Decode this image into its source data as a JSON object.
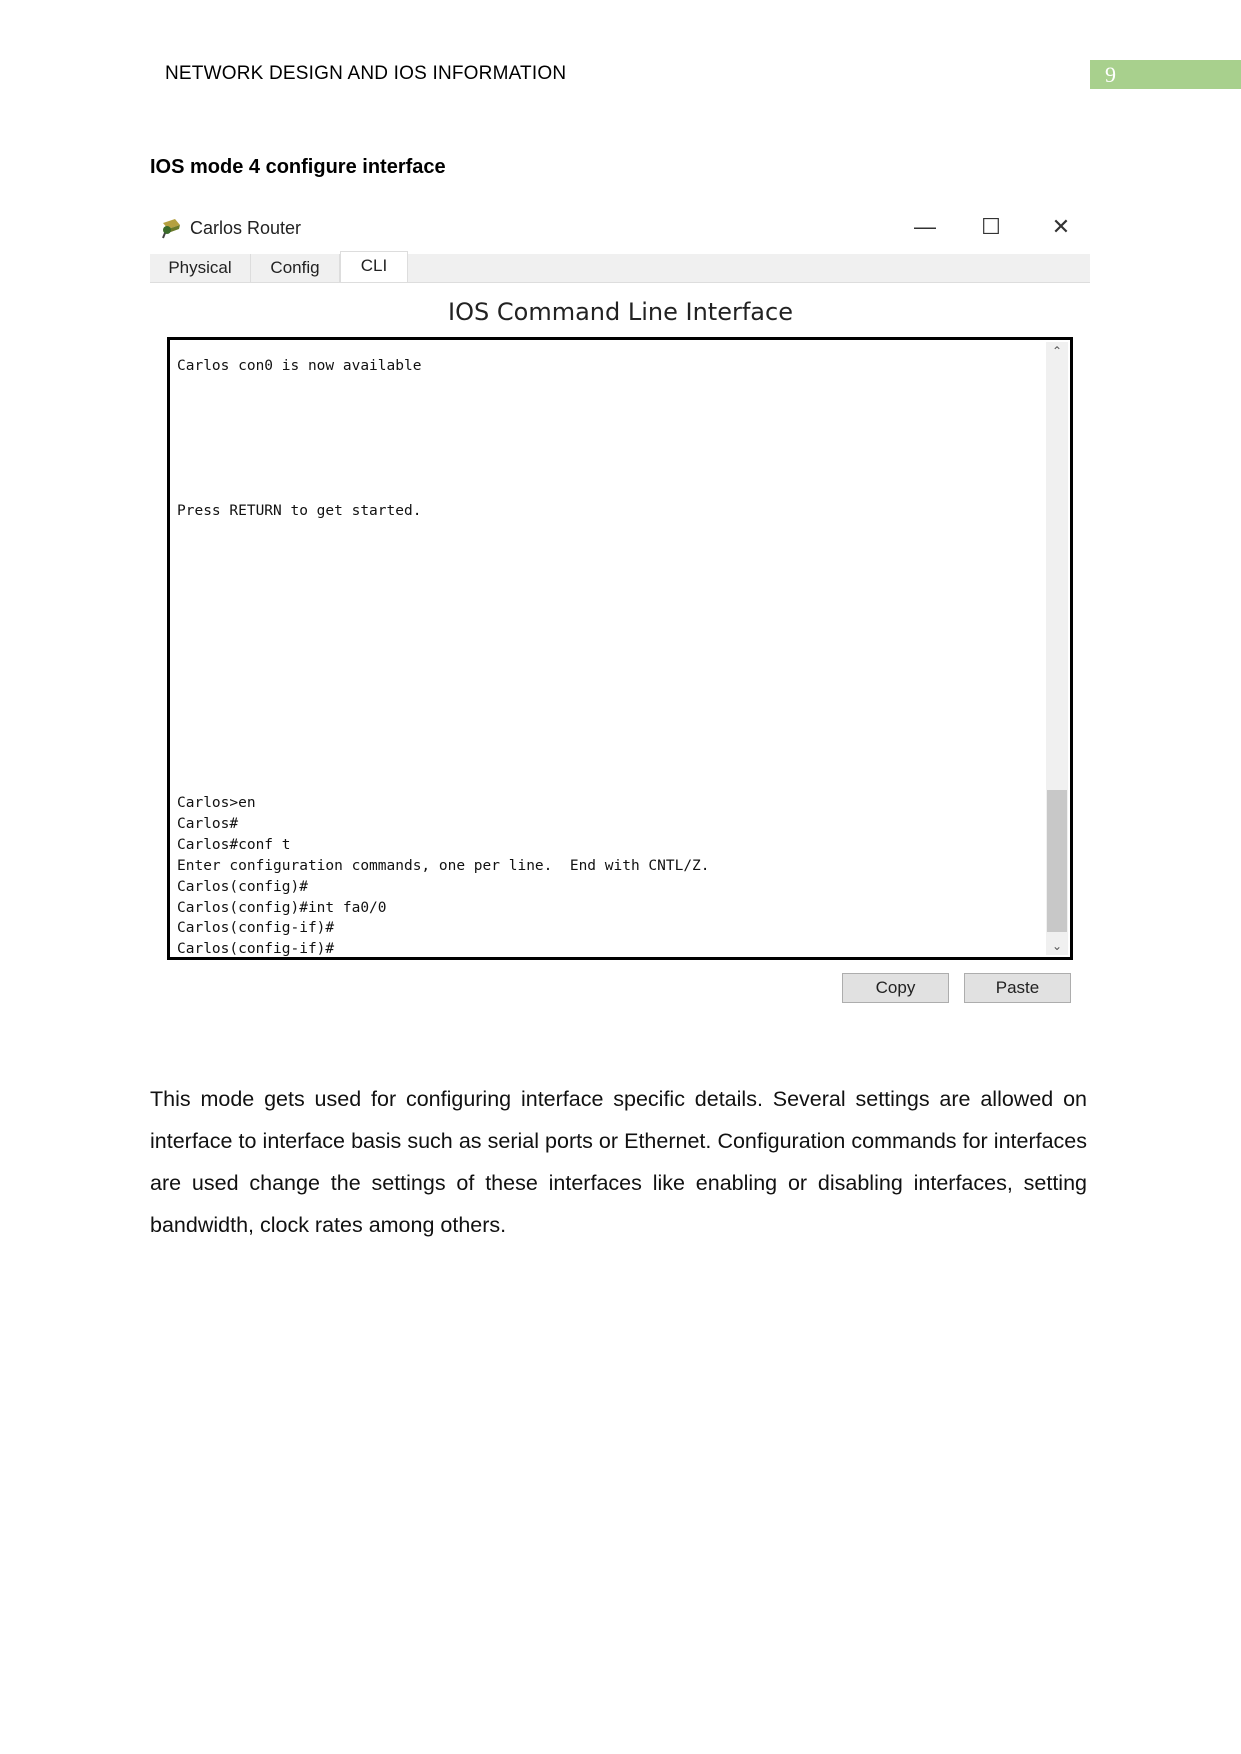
{
  "header": {
    "title": "NETWORK DESIGN AND IOS INFORMATION",
    "page_number": "9",
    "accent": "#a8d08d"
  },
  "heading": "IOS mode 4 configure interface",
  "window": {
    "title": "Carlos Router",
    "controls": {
      "minimize": "—",
      "maximize": "☐",
      "close": "✕"
    },
    "tabs": [
      {
        "label": "Physical"
      },
      {
        "label": "Config"
      },
      {
        "label": "CLI",
        "active": true
      }
    ],
    "panel_title": "IOS Command Line Interface",
    "terminal_lines": [
      "Carlos con0 is now available",
      "Press RETURN to get started.",
      "Carlos>en",
      "Carlos#",
      "Carlos#conf t",
      "Enter configuration commands, one per line.  End with CNTL/Z.",
      "Carlos(config)#",
      "Carlos(config)#int fa0/0",
      "Carlos(config-if)#",
      "Carlos(config-if)#"
    ],
    "buttons": {
      "copy": "Copy",
      "paste": "Paste"
    }
  },
  "paragraph": "This mode gets used for configuring interface specific details. Several settings are allowed on interface to interface basis such as serial ports or Ethernet. Configuration commands for interfaces are used change the settings of these interfaces like enabling or disabling interfaces, setting bandwidth, clock rates among others."
}
